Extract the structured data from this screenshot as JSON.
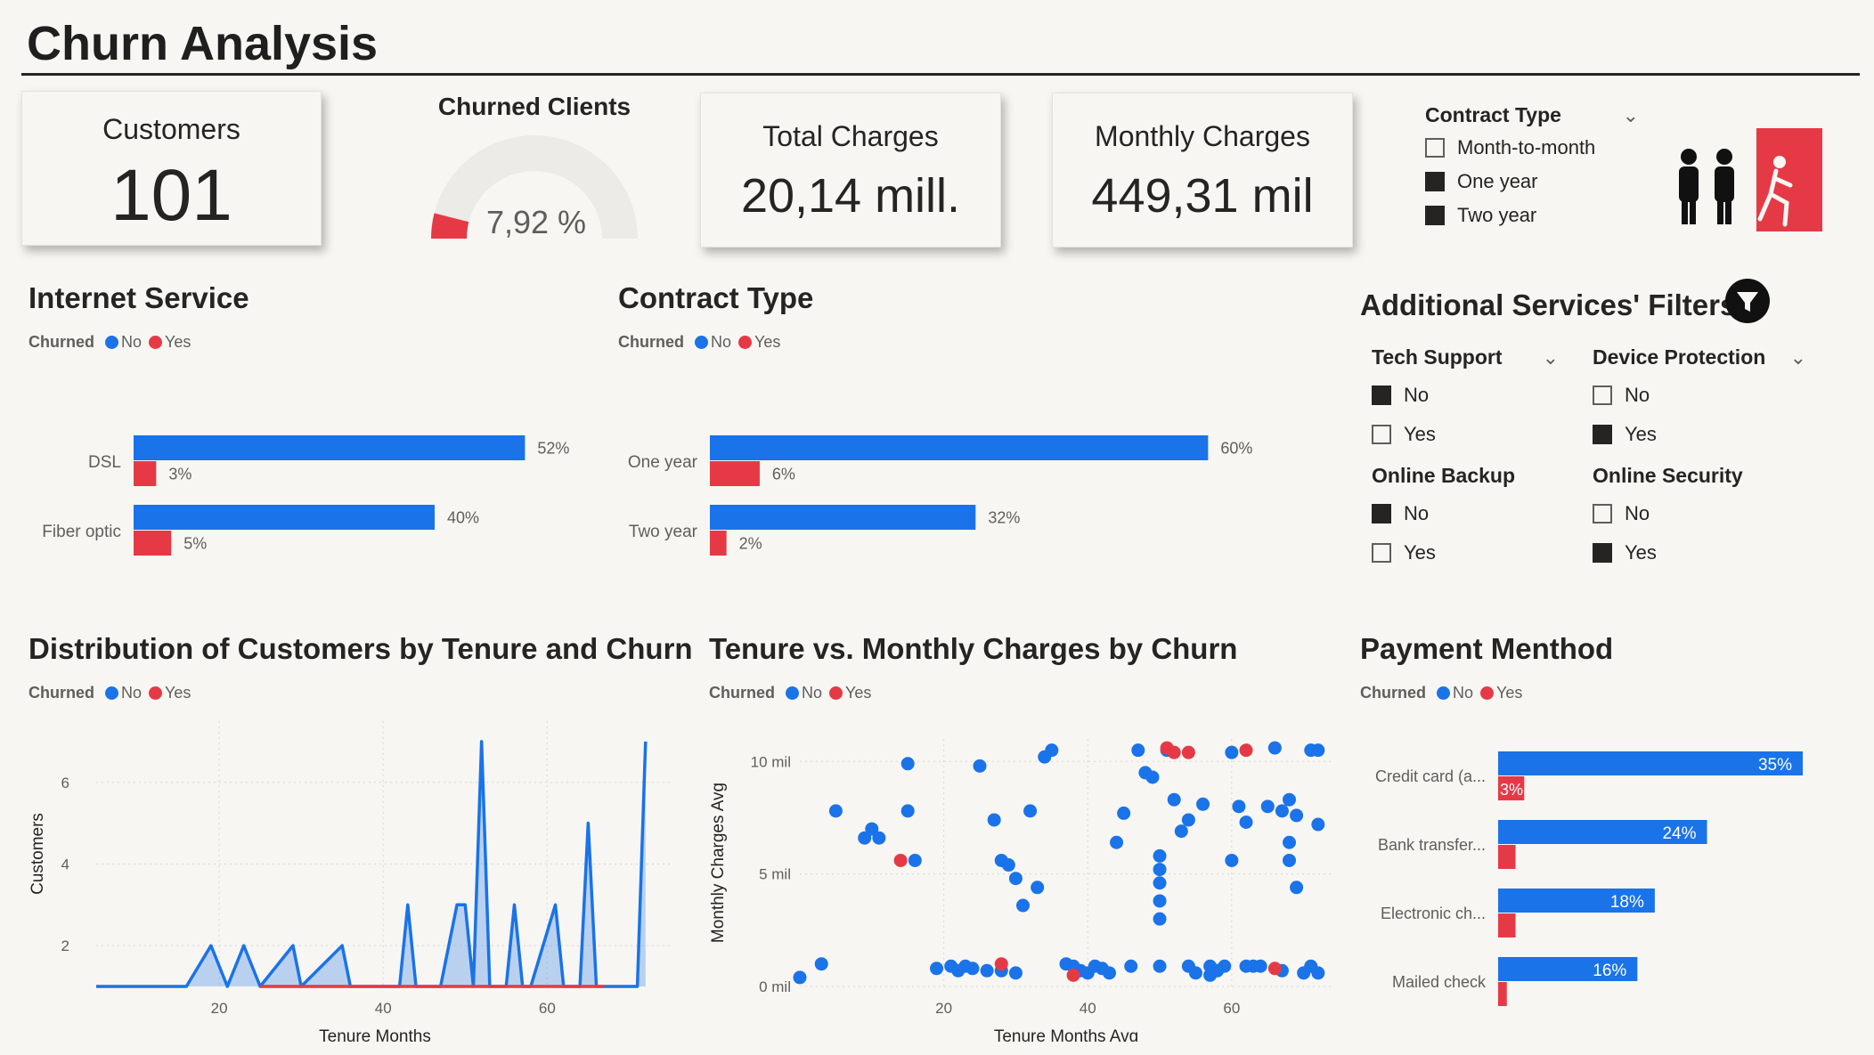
{
  "page": {
    "title": "Churn Analysis"
  },
  "colors": {
    "no": "#1a73e8",
    "yes": "#e63946",
    "text": "#252423",
    "muted": "#605e5c"
  },
  "kpis": {
    "customers": {
      "label": "Customers",
      "value": "101"
    },
    "churned": {
      "label": "Churned Clients",
      "value": "7,92 %",
      "fraction": 0.0792
    },
    "total_charges": {
      "label": "Total Charges",
      "value": "20,14 mill."
    },
    "monthly_charges": {
      "label": "Monthly Charges",
      "value": "449,31 mil"
    }
  },
  "contract_slicer": {
    "title": "Contract Type",
    "options": [
      {
        "label": "Month-to-month",
        "checked": false
      },
      {
        "label": "One year",
        "checked": true
      },
      {
        "label": "Two year",
        "checked": true
      }
    ]
  },
  "legend": {
    "title": "Churned",
    "no": "No",
    "yes": "Yes"
  },
  "additional": {
    "title": "Additional Services' Filters",
    "tech_support": {
      "title": "Tech Support",
      "options": [
        {
          "label": "No",
          "checked": true
        },
        {
          "label": "Yes",
          "checked": false
        }
      ]
    },
    "device_protection": {
      "title": "Device Protection",
      "options": [
        {
          "label": "No",
          "checked": false
        },
        {
          "label": "Yes",
          "checked": true
        }
      ]
    },
    "online_backup": {
      "title": "Online Backup",
      "options": [
        {
          "label": "No",
          "checked": true
        },
        {
          "label": "Yes",
          "checked": false
        }
      ]
    },
    "online_security": {
      "title": "Online Security",
      "options": [
        {
          "label": "No",
          "checked": false
        },
        {
          "label": "Yes",
          "checked": true
        }
      ]
    }
  },
  "chart_data": [
    {
      "id": "internet",
      "type": "bar",
      "title": "Internet Service",
      "categories": [
        "DSL",
        "Fiber optic"
      ],
      "series": [
        {
          "name": "No",
          "values": [
            52,
            40
          ]
        },
        {
          "name": "Yes",
          "values": [
            3,
            5
          ]
        }
      ],
      "labels": [
        [
          "52%",
          "40%"
        ],
        [
          "3%",
          "5%"
        ]
      ],
      "xlim": [
        0,
        60
      ]
    },
    {
      "id": "contract",
      "type": "bar",
      "title": "Contract Type",
      "categories": [
        "One year",
        "Two year"
      ],
      "series": [
        {
          "name": "No",
          "values": [
            60,
            32
          ]
        },
        {
          "name": "Yes",
          "values": [
            6,
            2
          ]
        }
      ],
      "labels": [
        [
          "60%",
          "32%"
        ],
        [
          "6%",
          "2%"
        ]
      ],
      "xlim": [
        0,
        62
      ]
    },
    {
      "id": "tenure",
      "type": "area",
      "title": "Distribution of Customers by Tenure and Churn",
      "xlabel": "Tenure Months",
      "ylabel": "Customers",
      "xticks": [
        20,
        40,
        60
      ],
      "yticks": [
        2,
        4,
        6
      ],
      "xlim": [
        5,
        73
      ],
      "ylim": [
        1,
        7.5
      ],
      "series": [
        {
          "name": "No",
          "x": [
            5,
            16,
            19,
            21,
            23,
            25,
            29,
            30,
            35,
            36,
            42,
            43,
            44,
            46,
            47,
            48,
            49,
            50,
            51,
            52,
            53,
            55,
            56,
            57,
            58,
            61,
            62,
            63,
            64,
            65,
            66,
            67,
            68,
            70,
            71,
            72
          ],
          "y": [
            1,
            1,
            2,
            1,
            2,
            1,
            2,
            1,
            2,
            1,
            1,
            3,
            1,
            1,
            1,
            2,
            3,
            3,
            1,
            7,
            1,
            1,
            3,
            1,
            1,
            3,
            1,
            1,
            1,
            5,
            1,
            1,
            1,
            1,
            1,
            7
          ]
        },
        {
          "name": "Yes",
          "x": [
            25,
            67
          ],
          "y": [
            1,
            1
          ]
        }
      ]
    },
    {
      "id": "scatter",
      "type": "scatter",
      "title": "Tenure vs. Monthly Charges by Churn",
      "xlabel": "Tenure Months Avg",
      "ylabel": "Monthly Charges Avg",
      "xticks": [
        20,
        40,
        60
      ],
      "yticks": [
        0,
        5,
        10
      ],
      "ytick_labels": [
        "0 mil",
        "5 mil",
        "10 mil"
      ],
      "xlim": [
        0,
        74
      ],
      "ylim": [
        0,
        11
      ],
      "series": [
        {
          "name": "No",
          "points": [
            [
              0,
              0.4
            ],
            [
              3,
              1
            ],
            [
              5,
              7.8
            ],
            [
              9,
              6.6
            ],
            [
              10,
              7
            ],
            [
              11,
              6.6
            ],
            [
              15,
              9.9
            ],
            [
              15,
              7.8
            ],
            [
              16,
              5.6
            ],
            [
              19,
              0.8
            ],
            [
              21,
              0.9
            ],
            [
              22,
              0.7
            ],
            [
              23,
              0.9
            ],
            [
              24,
              0.8
            ],
            [
              25,
              9.8
            ],
            [
              26,
              0.7
            ],
            [
              27,
              7.4
            ],
            [
              28,
              0.7
            ],
            [
              28,
              5.6
            ],
            [
              29,
              5.4
            ],
            [
              30,
              4.8
            ],
            [
              30,
              0.6
            ],
            [
              31,
              3.6
            ],
            [
              32,
              7.8
            ],
            [
              33,
              4.4
            ],
            [
              34,
              10.2
            ],
            [
              35,
              10.5
            ],
            [
              37,
              1
            ],
            [
              38,
              0.9
            ],
            [
              39,
              0.7
            ],
            [
              40,
              0.6
            ],
            [
              41,
              0.9
            ],
            [
              42,
              0.8
            ],
            [
              43,
              0.6
            ],
            [
              44,
              6.4
            ],
            [
              45,
              7.7
            ],
            [
              46,
              0.9
            ],
            [
              47,
              10.5
            ],
            [
              48,
              9.5
            ],
            [
              49,
              9.3
            ],
            [
              50,
              5.8
            ],
            [
              50,
              5.2
            ],
            [
              50,
              4.6
            ],
            [
              50,
              3.8
            ],
            [
              50,
              3
            ],
            [
              50,
              0.9
            ],
            [
              51,
              10.5
            ],
            [
              52,
              8.3
            ],
            [
              53,
              6.9
            ],
            [
              54,
              0.9
            ],
            [
              54,
              7.4
            ],
            [
              55,
              0.6
            ],
            [
              56,
              8.1
            ],
            [
              57,
              0.5
            ],
            [
              57,
              0.9
            ],
            [
              58,
              0.7
            ],
            [
              59,
              0.9
            ],
            [
              60,
              10.4
            ],
            [
              60,
              5.6
            ],
            [
              61,
              8
            ],
            [
              62,
              7.3
            ],
            [
              62,
              0.9
            ],
            [
              63,
              0.9
            ],
            [
              64,
              0.9
            ],
            [
              65,
              8
            ],
            [
              66,
              10.6
            ],
            [
              67,
              0.7
            ],
            [
              67,
              7.8
            ],
            [
              68,
              6.4
            ],
            [
              68,
              8.3
            ],
            [
              68,
              5.6
            ],
            [
              69,
              4.4
            ],
            [
              69,
              7.6
            ],
            [
              70,
              0.6
            ],
            [
              71,
              0.9
            ],
            [
              71,
              10.5
            ],
            [
              72,
              10.5
            ],
            [
              72,
              7.2
            ],
            [
              72,
              0.6
            ]
          ]
        },
        {
          "name": "Yes",
          "points": [
            [
              14,
              5.6
            ],
            [
              28,
              1
            ],
            [
              38,
              0.5
            ],
            [
              51,
              10.6
            ],
            [
              52,
              10.4
            ],
            [
              54,
              10.4
            ],
            [
              62,
              10.5
            ],
            [
              66,
              0.8
            ]
          ]
        }
      ]
    },
    {
      "id": "payment",
      "type": "bar",
      "title": "Payment Menthod",
      "categories": [
        "Credit card (a...",
        "Bank transfer...",
        "Electronic ch...",
        "Mailed check"
      ],
      "series": [
        {
          "name": "No",
          "values": [
            35,
            24,
            18,
            16
          ]
        },
        {
          "name": "Yes",
          "values": [
            3,
            2,
            2,
            1
          ]
        }
      ],
      "labels": [
        [
          "35%",
          "24%",
          "18%",
          "16%"
        ],
        [
          "3%",
          "",
          "",
          ""
        ]
      ],
      "xlim": [
        0,
        35
      ]
    }
  ]
}
